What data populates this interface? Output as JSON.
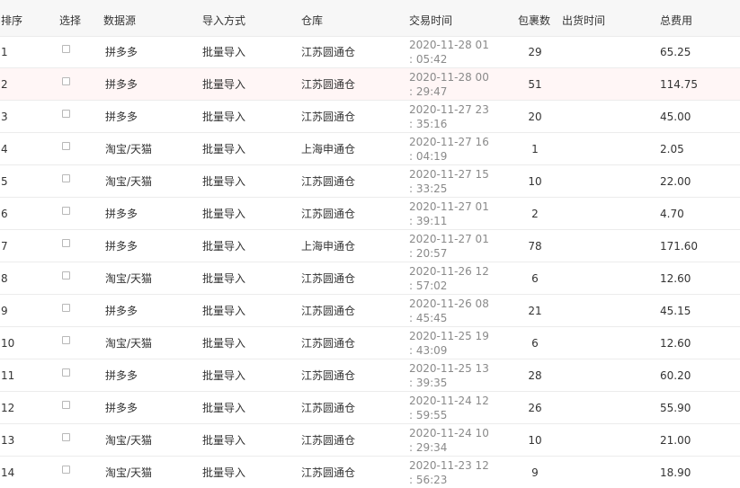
{
  "columns": {
    "index": "排序",
    "select": "选择",
    "source": "数据源",
    "import_mode": "导入方式",
    "warehouse": "仓库",
    "trade_time": "交易时间",
    "packages": "包裹数",
    "ship_time": "出货时间",
    "total_fee": "总费用"
  },
  "rows": [
    {
      "index": "1",
      "source": "拼多多",
      "import_mode": "批量导入",
      "warehouse": "江苏圆通仓",
      "trade_time": "2020-11-28 01 : 05:42",
      "packages": "29",
      "ship_time": "",
      "total_fee": "65.25"
    },
    {
      "index": "2",
      "source": "拼多多",
      "import_mode": "批量导入",
      "warehouse": "江苏圆通仓",
      "trade_time": "2020-11-28 00 : 29:47",
      "packages": "51",
      "ship_time": "",
      "total_fee": "114.75"
    },
    {
      "index": "3",
      "source": "拼多多",
      "import_mode": "批量导入",
      "warehouse": "江苏圆通仓",
      "trade_time": "2020-11-27 23 : 35:16",
      "packages": "20",
      "ship_time": "",
      "total_fee": "45.00"
    },
    {
      "index": "4",
      "source": "淘宝/天猫",
      "import_mode": "批量导入",
      "warehouse": "上海申通仓",
      "trade_time": "2020-11-27 16 : 04:19",
      "packages": "1",
      "ship_time": "",
      "total_fee": "2.05"
    },
    {
      "index": "5",
      "source": "淘宝/天猫",
      "import_mode": "批量导入",
      "warehouse": "江苏圆通仓",
      "trade_time": "2020-11-27 15 : 33:25",
      "packages": "10",
      "ship_time": "",
      "total_fee": "22.00"
    },
    {
      "index": "6",
      "source": "拼多多",
      "import_mode": "批量导入",
      "warehouse": "江苏圆通仓",
      "trade_time": "2020-11-27 01 : 39:11",
      "packages": "2",
      "ship_time": "",
      "total_fee": "4.70"
    },
    {
      "index": "7",
      "source": "拼多多",
      "import_mode": "批量导入",
      "warehouse": "上海申通仓",
      "trade_time": "2020-11-27 01 : 20:57",
      "packages": "78",
      "ship_time": "",
      "total_fee": "171.60"
    },
    {
      "index": "8",
      "source": "淘宝/天猫",
      "import_mode": "批量导入",
      "warehouse": "江苏圆通仓",
      "trade_time": "2020-11-26 12 : 57:02",
      "packages": "6",
      "ship_time": "",
      "total_fee": "12.60"
    },
    {
      "index": "9",
      "source": "拼多多",
      "import_mode": "批量导入",
      "warehouse": "江苏圆通仓",
      "trade_time": "2020-11-26 08 : 45:45",
      "packages": "21",
      "ship_time": "",
      "total_fee": "45.15"
    },
    {
      "index": "10",
      "source": "淘宝/天猫",
      "import_mode": "批量导入",
      "warehouse": "江苏圆通仓",
      "trade_time": "2020-11-25 19 : 43:09",
      "packages": "6",
      "ship_time": "",
      "total_fee": "12.60"
    },
    {
      "index": "11",
      "source": "拼多多",
      "import_mode": "批量导入",
      "warehouse": "江苏圆通仓",
      "trade_time": "2020-11-25 13 : 39:35",
      "packages": "28",
      "ship_time": "",
      "total_fee": "60.20"
    },
    {
      "index": "12",
      "source": "拼多多",
      "import_mode": "批量导入",
      "warehouse": "江苏圆通仓",
      "trade_time": "2020-11-24 12 : 59:55",
      "packages": "26",
      "ship_time": "",
      "total_fee": "55.90"
    },
    {
      "index": "13",
      "source": "淘宝/天猫",
      "import_mode": "批量导入",
      "warehouse": "江苏圆通仓",
      "trade_time": "2020-11-24 10 : 29:34",
      "packages": "10",
      "ship_time": "",
      "total_fee": "21.00"
    },
    {
      "index": "14",
      "source": "淘宝/天猫",
      "import_mode": "批量导入",
      "warehouse": "江苏圆通仓",
      "trade_time": "2020-11-23 12 : 56:23",
      "packages": "9",
      "ship_time": "",
      "total_fee": "18.90"
    }
  ],
  "hover_row": 1,
  "colors": {
    "header_bg": "#f7f7f7",
    "row_border": "#ececec",
    "hover_bg": "#fff6f6",
    "time_text": "#8a8a8a"
  }
}
